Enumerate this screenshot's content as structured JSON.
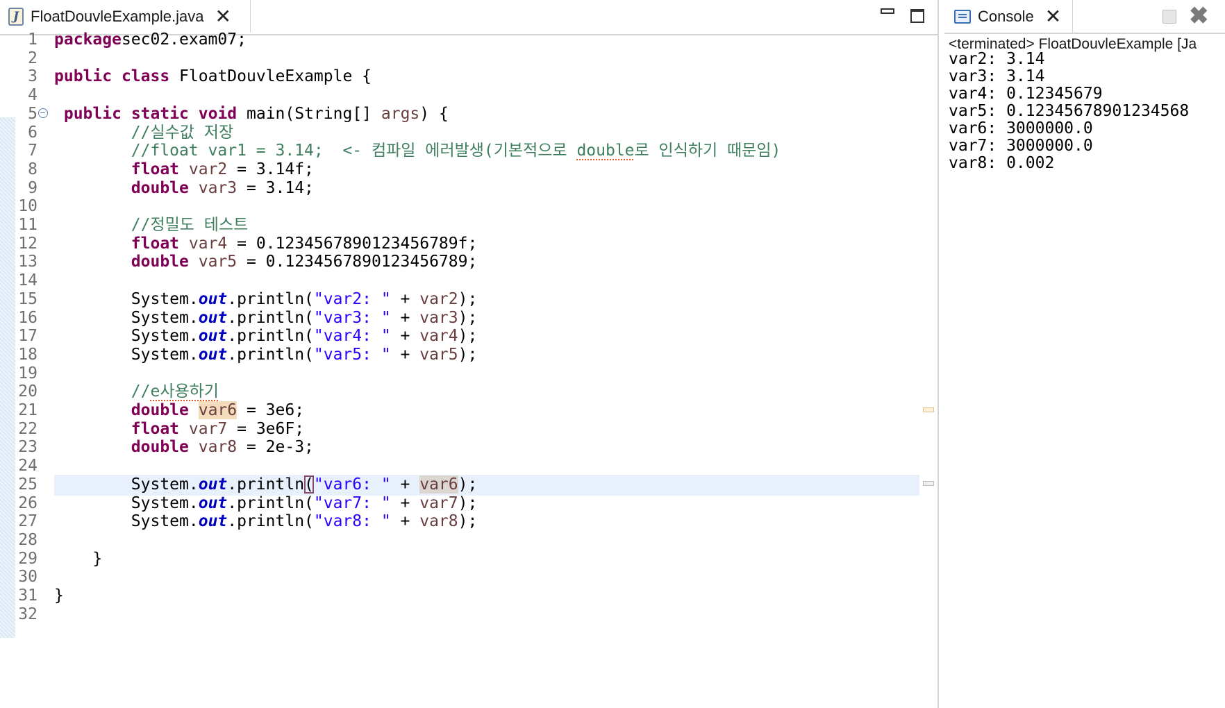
{
  "editor": {
    "tab_title": "FloatDouvleExample.java",
    "tab_icon": "java-file-icon",
    "close_glyph": "✕"
  },
  "console": {
    "tab_title": "Console",
    "close_glyph": "✕",
    "remove_glyph": "✖",
    "status": "<terminated> FloatDouvleExample [Ja",
    "output": [
      "var2: 3.14",
      "var3: 3.14",
      "var4: 0.12345679",
      "var5: 0.12345678901234568",
      "var6: 3000000.0",
      "var7: 3000000.0",
      "var8: 0.002"
    ]
  },
  "colors": {
    "keyword": "#7f0055",
    "comment": "#3f7f5f",
    "string": "#2a00ff",
    "static_field": "#0000c0",
    "local_variable": "#6a3e3e",
    "current_line": "#e8f1fb"
  },
  "code": {
    "current_line": 25,
    "lines": [
      {
        "n": "1",
        "tokens": [
          [
            "kw",
            "package"
          ],
          [
            "",
            "sec02.exam07;"
          ]
        ]
      },
      {
        "n": "2",
        "tokens": []
      },
      {
        "n": "3",
        "tokens": [
          [
            "kw",
            "public"
          ],
          [
            "",
            " "
          ],
          [
            "kw",
            "class"
          ],
          [
            "",
            " FloatDouvleExample {"
          ]
        ]
      },
      {
        "n": "4",
        "tokens": []
      },
      {
        "n": "5",
        "fold": true,
        "tokens": [
          [
            "",
            " "
          ],
          [
            "kw",
            "public"
          ],
          [
            "",
            " "
          ],
          [
            "kw",
            "static"
          ],
          [
            "",
            " "
          ],
          [
            "kw",
            "void"
          ],
          [
            "",
            " main(String[] "
          ],
          [
            "var",
            "args"
          ],
          [
            "",
            ") {"
          ]
        ]
      },
      {
        "n": "6",
        "tokens": [
          [
            "",
            "        "
          ],
          [
            "cm",
            "//실수값 저장"
          ]
        ]
      },
      {
        "n": "7",
        "tokens": [
          [
            "",
            "        "
          ],
          [
            "cm",
            "//float var1 = 3.14;  <- 컴파일 에러발생(기본적으로 "
          ],
          [
            "cm dotted",
            "double"
          ],
          [
            "cm",
            "로 인식하기 때문임)"
          ]
        ]
      },
      {
        "n": "8",
        "tokens": [
          [
            "",
            "        "
          ],
          [
            "kw",
            "float"
          ],
          [
            "",
            " "
          ],
          [
            "var",
            "var2"
          ],
          [
            "",
            " = 3.14f;"
          ]
        ]
      },
      {
        "n": "9",
        "tokens": [
          [
            "",
            "        "
          ],
          [
            "kw",
            "double"
          ],
          [
            "",
            " "
          ],
          [
            "var",
            "var3"
          ],
          [
            "",
            " = 3.14;"
          ]
        ]
      },
      {
        "n": "10",
        "tokens": []
      },
      {
        "n": "11",
        "tokens": [
          [
            "",
            "        "
          ],
          [
            "cm",
            "//정밀도 테스트"
          ]
        ]
      },
      {
        "n": "12",
        "tokens": [
          [
            "",
            "        "
          ],
          [
            "kw",
            "float"
          ],
          [
            "",
            " "
          ],
          [
            "var",
            "var4"
          ],
          [
            "",
            " = 0.1234567890123456789f;"
          ]
        ]
      },
      {
        "n": "13",
        "tokens": [
          [
            "",
            "        "
          ],
          [
            "kw",
            "double"
          ],
          [
            "",
            " "
          ],
          [
            "var",
            "var5"
          ],
          [
            "",
            " = 0.1234567890123456789;"
          ]
        ]
      },
      {
        "n": "14",
        "tokens": []
      },
      {
        "n": "15",
        "tokens": [
          [
            "",
            "        System."
          ],
          [
            "fld",
            "out"
          ],
          [
            "",
            ".println("
          ],
          [
            "str",
            "\"var2: \""
          ],
          [
            "",
            " + "
          ],
          [
            "var",
            "var2"
          ],
          [
            "",
            ");"
          ]
        ]
      },
      {
        "n": "16",
        "tokens": [
          [
            "",
            "        System."
          ],
          [
            "fld",
            "out"
          ],
          [
            "",
            ".println("
          ],
          [
            "str",
            "\"var3: \""
          ],
          [
            "",
            " + "
          ],
          [
            "var",
            "var3"
          ],
          [
            "",
            ");"
          ]
        ]
      },
      {
        "n": "17",
        "tokens": [
          [
            "",
            "        System."
          ],
          [
            "fld",
            "out"
          ],
          [
            "",
            ".println("
          ],
          [
            "str",
            "\"var4: \""
          ],
          [
            "",
            " + "
          ],
          [
            "var",
            "var4"
          ],
          [
            "",
            ");"
          ]
        ]
      },
      {
        "n": "18",
        "tokens": [
          [
            "",
            "        System."
          ],
          [
            "fld",
            "out"
          ],
          [
            "",
            ".println("
          ],
          [
            "str",
            "\"var5: \""
          ],
          [
            "",
            " + "
          ],
          [
            "var",
            "var5"
          ],
          [
            "",
            ");"
          ]
        ]
      },
      {
        "n": "19",
        "tokens": []
      },
      {
        "n": "20",
        "tokens": [
          [
            "",
            "        "
          ],
          [
            "cm",
            "//"
          ],
          [
            "cm dotted",
            "e사용하기"
          ]
        ]
      },
      {
        "n": "21",
        "tokens": [
          [
            "",
            "        "
          ],
          [
            "kw",
            "double"
          ],
          [
            "",
            " "
          ],
          [
            "var occ",
            "var6"
          ],
          [
            "",
            " = 3e6;"
          ]
        ]
      },
      {
        "n": "22",
        "tokens": [
          [
            "",
            "        "
          ],
          [
            "kw",
            "float"
          ],
          [
            "",
            " "
          ],
          [
            "var",
            "var7"
          ],
          [
            "",
            " = 3e6F;"
          ]
        ]
      },
      {
        "n": "23",
        "tokens": [
          [
            "",
            "        "
          ],
          [
            "kw",
            "double"
          ],
          [
            "",
            " "
          ],
          [
            "var",
            "var8"
          ],
          [
            "",
            " = 2e-3;"
          ]
        ]
      },
      {
        "n": "24",
        "tokens": []
      },
      {
        "n": "25",
        "tokens": [
          [
            "",
            "        System."
          ],
          [
            "fld",
            "out"
          ],
          [
            "",
            ".println"
          ],
          [
            "bracket",
            "("
          ],
          [
            "str",
            "\"var6: \""
          ],
          [
            "",
            " + "
          ],
          [
            "var occ2",
            "var6"
          ],
          [
            "",
            ");"
          ]
        ]
      },
      {
        "n": "26",
        "tokens": [
          [
            "",
            "        System."
          ],
          [
            "fld",
            "out"
          ],
          [
            "",
            ".println("
          ],
          [
            "str",
            "\"var7: \""
          ],
          [
            "",
            " + "
          ],
          [
            "var",
            "var7"
          ],
          [
            "",
            ");"
          ]
        ]
      },
      {
        "n": "27",
        "tokens": [
          [
            "",
            "        System."
          ],
          [
            "fld",
            "out"
          ],
          [
            "",
            ".println("
          ],
          [
            "str",
            "\"var8: \""
          ],
          [
            "",
            " + "
          ],
          [
            "var",
            "var8"
          ],
          [
            "",
            ");"
          ]
        ]
      },
      {
        "n": "28",
        "tokens": []
      },
      {
        "n": "29",
        "tokens": [
          [
            "",
            "    }"
          ]
        ]
      },
      {
        "n": "30",
        "tokens": []
      },
      {
        "n": "31",
        "tokens": [
          [
            "",
            "}"
          ]
        ]
      },
      {
        "n": "32",
        "tokens": []
      }
    ]
  }
}
